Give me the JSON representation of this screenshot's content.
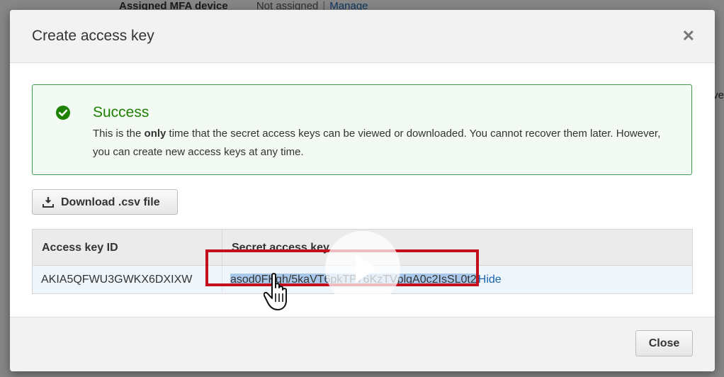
{
  "background": {
    "mfa_label": "Assigned MFA device",
    "mfa_value": "Not assigned",
    "mfa_link": "Manage",
    "edge_text": "ve"
  },
  "modal": {
    "title": "Create access key",
    "close_icon": "close-icon",
    "alert": {
      "icon": "check-circle-icon",
      "title": "Success",
      "body_before": "This is the ",
      "body_bold": "only",
      "body_after": " time that the secret access keys can be viewed or downloaded. You cannot recover them later. However, you can create new access keys at any time."
    },
    "download_button": {
      "icon": "download-icon",
      "label": "Download .csv file"
    },
    "table": {
      "headers": [
        "Access key ID",
        "Secret access key"
      ],
      "rows": [
        {
          "access_key_id": "AKIA5QFWU3GWKX6DXIXW",
          "secret_access_key": "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",
          "toggle_label": "Hide"
        }
      ]
    },
    "footer": {
      "close_label": "Close"
    }
  },
  "video_overlay": {
    "icon": "play-icon"
  },
  "colors": {
    "success": "#1d8102",
    "alert_border": "#3d9e4e",
    "link": "#1a64b0",
    "highlight": "#c4101e",
    "selection": "#a9c8ea"
  }
}
